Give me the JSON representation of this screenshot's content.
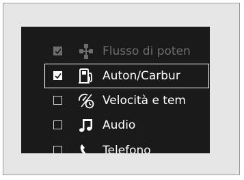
{
  "menu": {
    "items": [
      {
        "label": "Flusso di poten",
        "icon": "power-flow-icon",
        "checked": true,
        "state": "disabled"
      },
      {
        "label": "Auton/Carbur",
        "icon": "fuel-pump-icon",
        "checked": true,
        "state": "selected"
      },
      {
        "label": "Velocità e tem",
        "icon": "speed-time-icon",
        "checked": false,
        "state": "normal"
      },
      {
        "label": "Audio",
        "icon": "music-note-icon",
        "checked": false,
        "state": "normal"
      },
      {
        "label": "Telefono",
        "icon": "phone-icon",
        "checked": false,
        "state": "normal"
      }
    ]
  },
  "colors": {
    "screen_bg": "#1a1a1a",
    "text": "#ffffff",
    "disabled": "#6e6e6e",
    "frame_bg": "#e6e6e6"
  }
}
